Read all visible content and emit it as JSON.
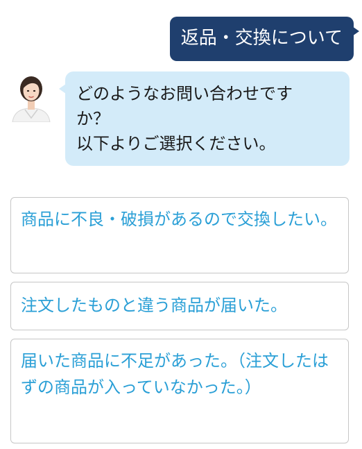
{
  "user_message": "返品・交換について",
  "bot_message": {
    "lines": [
      "どのようなお問い合わせです",
      "か？",
      "以下よりご選択ください。"
    ]
  },
  "options": [
    {
      "label": "商品に不良・破損があるので交換したい。"
    },
    {
      "label": "注文したものと違う商品が届いた。"
    },
    {
      "label": "届いた商品に不足があった。（注文したはずの商品が入っていなかった。）"
    }
  ],
  "colors": {
    "user_bubble": "#1f3f6e",
    "bot_bubble": "#d3ebf9",
    "option_text": "#2a9fd6",
    "option_border": "#c6c6c6"
  }
}
